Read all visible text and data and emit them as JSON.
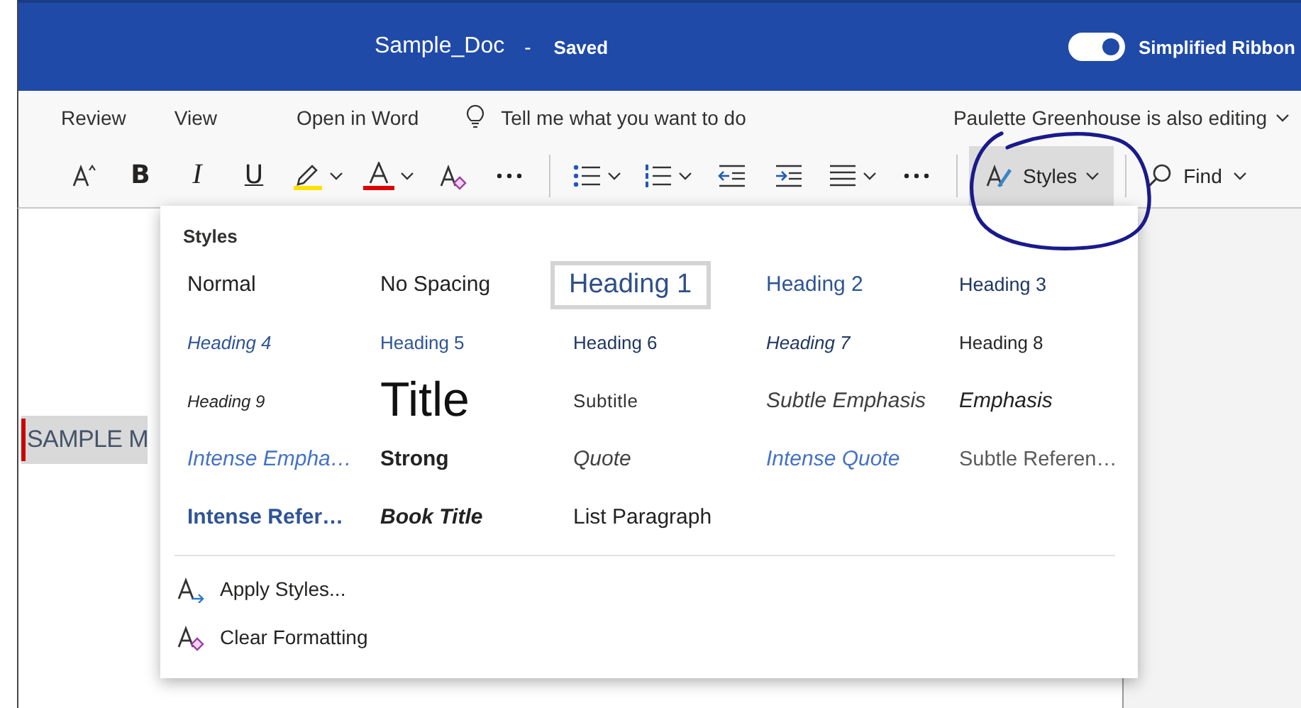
{
  "title_bar": {
    "document": "Sample_Doc",
    "separator": "-",
    "status": "Saved",
    "simplified_ribbon": {
      "label": "Simplified Ribbon",
      "on": true
    }
  },
  "menu": {
    "items": [
      {
        "kind": "tab",
        "label": "Review"
      },
      {
        "kind": "tab",
        "label": "View"
      },
      {
        "kind": "command",
        "label": "Open in Word"
      },
      {
        "kind": "search",
        "label": "Tell me what you want to do"
      }
    ],
    "coauthor": "Paulette Greenhouse is also editing"
  },
  "toolbar": {
    "buttons": [
      {
        "kind": "grow-font"
      },
      {
        "kind": "bold",
        "glyph": "B"
      },
      {
        "kind": "italic",
        "glyph": "I"
      },
      {
        "kind": "underline",
        "glyph": "U"
      },
      {
        "kind": "highlight"
      },
      {
        "kind": "font-color"
      },
      {
        "kind": "clear-format"
      },
      {
        "kind": "more"
      },
      {
        "kind": "divider"
      },
      {
        "kind": "bullets"
      },
      {
        "kind": "numbering"
      },
      {
        "kind": "outdent"
      },
      {
        "kind": "indent"
      },
      {
        "kind": "align"
      },
      {
        "kind": "more"
      },
      {
        "kind": "divider"
      },
      {
        "kind": "styles",
        "label": "Styles",
        "expanded": true
      },
      {
        "kind": "divider"
      },
      {
        "kind": "find",
        "label": "Find"
      }
    ]
  },
  "document": {
    "text": "SAMPLE M",
    "selected": true
  },
  "styles_menu": {
    "title": "Styles",
    "styles": [
      {
        "name": "Normal",
        "kind": "normal",
        "selected": false
      },
      {
        "name": "No Spacing",
        "kind": "normal",
        "selected": false
      },
      {
        "name": "Heading 1",
        "kind": "heading-1",
        "selected": true
      },
      {
        "name": "Heading 2",
        "kind": "heading-2",
        "selected": false
      },
      {
        "name": "Heading 3",
        "kind": "heading-3",
        "selected": false
      },
      {
        "name": "Heading 4",
        "kind": "heading-4",
        "selected": false
      },
      {
        "name": "Heading 5",
        "kind": "heading-5",
        "selected": false
      },
      {
        "name": "Heading 6",
        "kind": "heading-6",
        "selected": false
      },
      {
        "name": "Heading 7",
        "kind": "heading-7",
        "selected": false
      },
      {
        "name": "Heading 8",
        "kind": "heading-8",
        "selected": false
      },
      {
        "name": "Heading 9",
        "kind": "heading-9",
        "selected": false
      },
      {
        "name": "Title",
        "kind": "title",
        "selected": false
      },
      {
        "name": "Subtitle",
        "kind": "subtitle",
        "selected": false
      },
      {
        "name": "Subtle Emphasis",
        "kind": "subtle-emphasis",
        "selected": false
      },
      {
        "name": "Emphasis",
        "kind": "emphasis",
        "selected": false
      },
      {
        "name": "Intense Empha…",
        "kind": "intense-emphasis",
        "selected": false
      },
      {
        "name": "Strong",
        "kind": "strong",
        "selected": false
      },
      {
        "name": "Quote",
        "kind": "quote",
        "selected": false
      },
      {
        "name": "Intense Quote",
        "kind": "intense-emphasis",
        "selected": false
      },
      {
        "name": "Subtle Referen…",
        "kind": "subtle-reference",
        "selected": false
      },
      {
        "name": "Intense Refer…",
        "kind": "intense-reference",
        "selected": false
      },
      {
        "name": "Book Title",
        "kind": "book-title",
        "selected": false
      },
      {
        "name": "List Paragraph",
        "kind": "normal",
        "selected": false
      }
    ],
    "actions": [
      {
        "kind": "apply",
        "label": "Apply Styles..."
      },
      {
        "kind": "clear",
        "label": "Clear Formatting"
      }
    ]
  }
}
